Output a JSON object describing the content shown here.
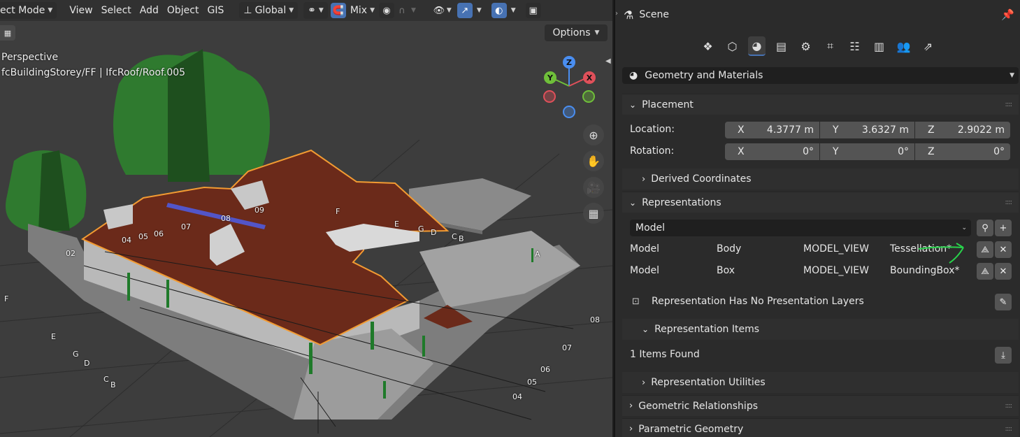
{
  "header": {
    "mode_label": "ect Mode",
    "menu": [
      "View",
      "Select",
      "Add",
      "Object",
      "GIS"
    ],
    "orientation_label": "Global",
    "snap_label": "Mix"
  },
  "viewport": {
    "view_label": "Perspective",
    "path_label": "fcBuildingStorey/FF | IfcRoof/Roof.005",
    "options_label": "Options",
    "gizmo": {
      "z": "Z",
      "y": "Y",
      "x": "X"
    },
    "grid_labels": [
      "04",
      "05",
      "06",
      "07",
      "08",
      "09",
      "F",
      "E",
      "G",
      "D",
      "C",
      "B",
      "A",
      "02",
      "F",
      "E",
      "G",
      "D",
      "C",
      "B",
      "08",
      "07",
      "06",
      "05",
      "04"
    ]
  },
  "props": {
    "title": "Scene",
    "category": "Geometry and Materials",
    "placement": {
      "title": "Placement",
      "location_label": "Location:",
      "rotation_label": "Rotation:",
      "location": [
        {
          "axis": "X",
          "value": "4.3777 m"
        },
        {
          "axis": "Y",
          "value": "3.6327 m"
        },
        {
          "axis": "Z",
          "value": "2.9022 m"
        }
      ],
      "rotation": [
        {
          "axis": "X",
          "value": "0°"
        },
        {
          "axis": "Y",
          "value": "0°"
        },
        {
          "axis": "Z",
          "value": "0°"
        }
      ],
      "derived": "Derived Coordinates"
    },
    "representations": {
      "title": "Representations",
      "context_select": "Model",
      "rows": [
        {
          "context": "Model",
          "subcontext": "Body",
          "target": "MODEL_VIEW",
          "type": "Tessellation*"
        },
        {
          "context": "Model",
          "subcontext": "Box",
          "target": "MODEL_VIEW",
          "type": "BoundingBox*"
        }
      ],
      "layers_text": "Representation Has No Presentation Layers"
    },
    "items": {
      "title": "Representation Items",
      "found": "1 Items Found"
    },
    "utilities": "Representation Utilities",
    "geom_rel": "Geometric Relationships",
    "param_geom": "Parametric Geometry"
  },
  "colors": {
    "accent": "#4772b3",
    "roof": "#6b2a1a",
    "selection": "#f29b32",
    "tree": "#2f7a2f"
  }
}
